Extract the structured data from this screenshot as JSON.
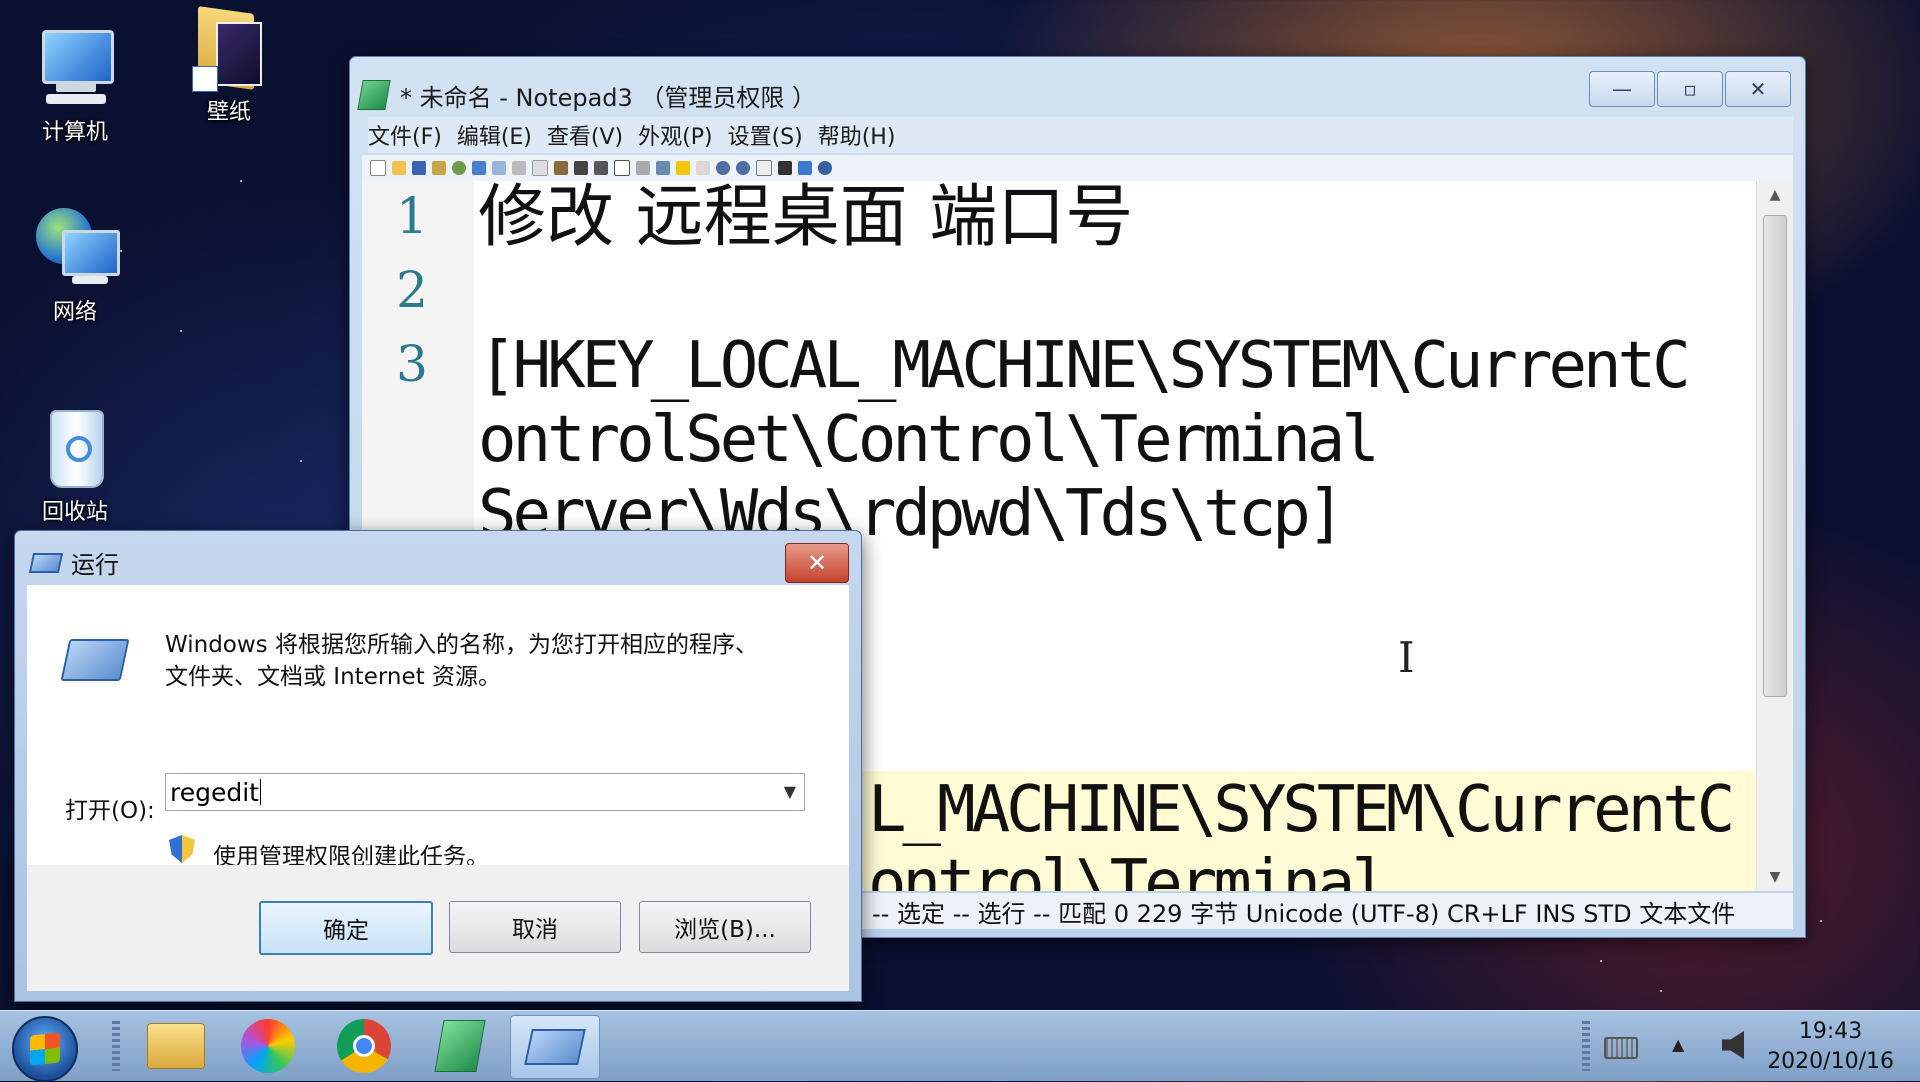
{
  "desktop": {
    "icons": [
      {
        "label": "计算机"
      },
      {
        "label": "壁纸"
      },
      {
        "label": "网络"
      },
      {
        "label": "回收站"
      }
    ]
  },
  "notepad": {
    "title": "* 未命名 - Notepad3 （管理员权限 ）",
    "menu": [
      "文件(F)",
      "编辑(E)",
      "查看(V)",
      "外观(P)",
      "设置(S)",
      "帮助(H)"
    ],
    "window_buttons": {
      "minimize": "—",
      "maximize": "▫",
      "close": "✕"
    },
    "line_numbers": [
      "1",
      "2",
      "3"
    ],
    "lines": [
      "修改 远程桌面 端口号",
      "[HKEY_LOCAL_MACHINE\\SYSTEM\\CurrentC",
      "ontrolSet\\Control\\Terminal",
      "Server\\Wds\\rdpwd\\Tds\\tcp]",
      "L_MACHINE\\SYSTEM\\CurrentC",
      "ontrol\\Terminal"
    ],
    "status": "--  选定  --  选行  --  匹配  0    229 字节  Unicode (UTF-8)  CR+LF  INS  STD  文本文件"
  },
  "run": {
    "title": "运行",
    "description_line1": "Windows 将根据您所输入的名称，为您打开相应的程序、",
    "description_line2": "文件夹、文档或 Internet 资源。",
    "open_label": "打开(O):",
    "input_value": "regedit",
    "admin_note": "使用管理权限创建此任务。",
    "buttons": {
      "ok": "确定",
      "cancel": "取消",
      "browse": "浏览(B)..."
    }
  },
  "taskbar": {
    "time": "19:43",
    "date": "2020/10/16"
  },
  "colors": {
    "line_number": "#2b7a91",
    "highlight_line": "#fffbd4",
    "taskbar": "#8fb0d6"
  }
}
